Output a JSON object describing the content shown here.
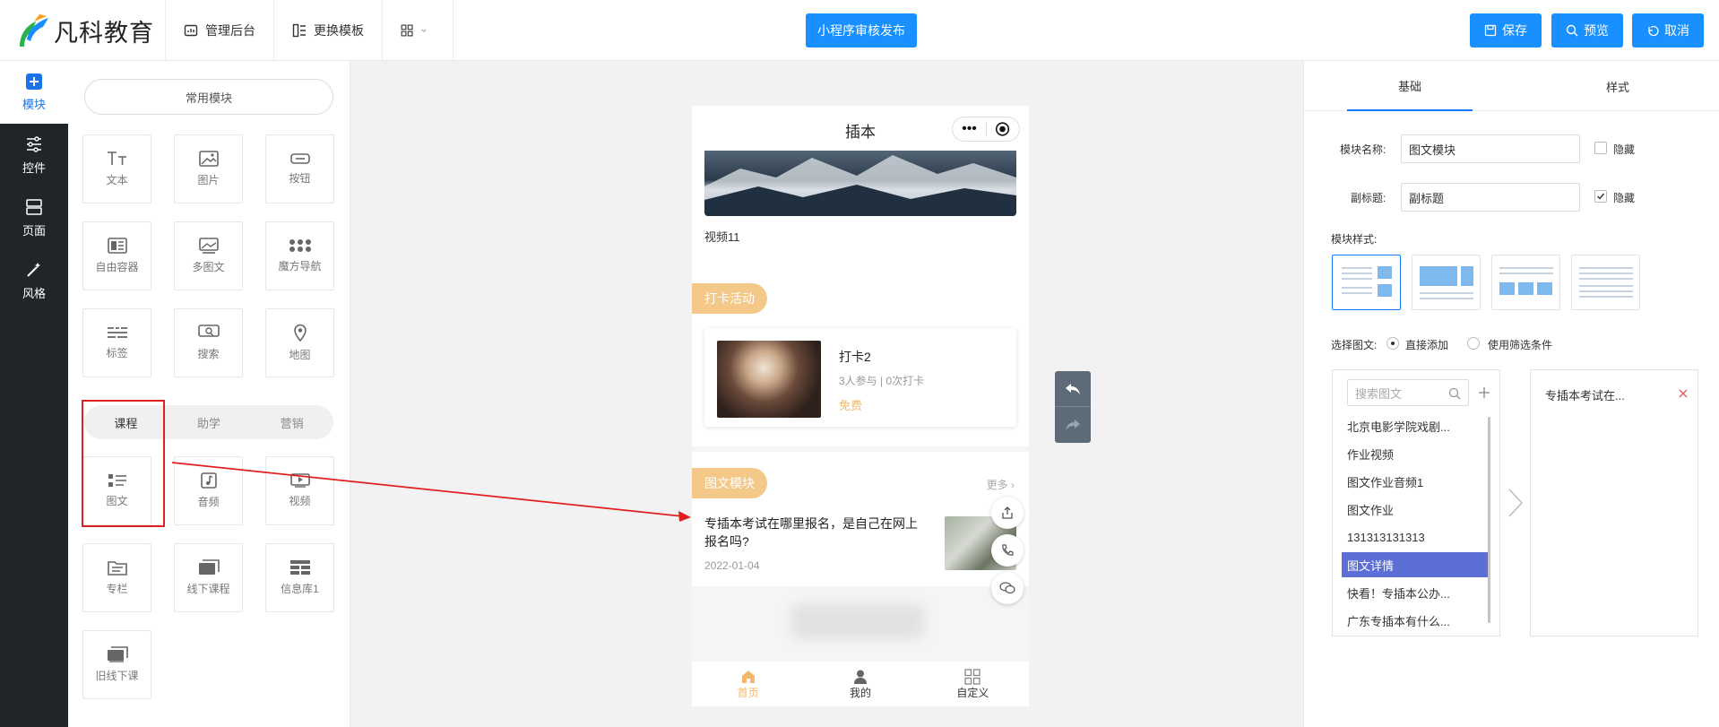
{
  "brand": {
    "name": "凡科教育"
  },
  "topnav": {
    "admin": "管理后台",
    "template": "更换模板",
    "publish": "小程序审核发布",
    "save": "保存",
    "preview": "预览",
    "cancel": "取消"
  },
  "rail": {
    "module": "模块",
    "control": "控件",
    "page": "页面",
    "style": "风格"
  },
  "modules": {
    "common_title": "常用模块",
    "common": [
      "文本",
      "图片",
      "按钮",
      "自由容器",
      "多图文",
      "魔方导航",
      "标签",
      "搜索",
      "地图"
    ],
    "tabs": [
      "课程",
      "助学",
      "营销"
    ],
    "course": [
      "图文",
      "音频",
      "视频",
      "专栏",
      "线下课程",
      "信息库1",
      "旧线下课"
    ]
  },
  "phone": {
    "title": "插本",
    "video_caption": "视频11",
    "checkin": {
      "tag": "打卡活动",
      "title": "打卡2",
      "meta": "3人参与 | 0次打卡",
      "price": "免费"
    },
    "article": {
      "tag": "图文模块",
      "more": "更多",
      "title": "专插本考试在哪里报名，是自己在网上报名吗?",
      "date": "2022-01-04"
    },
    "tabbar": [
      "首页",
      "我的",
      "自定义"
    ]
  },
  "settings": {
    "tab_basic": "基础",
    "tab_style": "样式",
    "name_label": "模块名称:",
    "name_value": "图文模块",
    "name_hide": "隐藏",
    "subtitle_label": "副标题:",
    "subtitle_value": "副标题",
    "subtitle_hide": "隐藏",
    "style_label": "模块样式:",
    "choose_label": "选择图文:",
    "opt_direct": "直接添加",
    "opt_filter": "使用筛选条件",
    "search_placeholder": "搜索图文",
    "list": [
      "北京电影学院戏剧...",
      "作业视频",
      "图文作业音频1",
      "图文作业",
      "131313131313",
      "图文详情",
      "快看！专插本公办...",
      "广东专插本有什么..."
    ],
    "selected": [
      "专插本考试在..."
    ]
  },
  "colors": {
    "accent": "#1890ff",
    "rail_bg": "#212529",
    "orange_tag": "#f3c888",
    "price": "#f3b96a",
    "annotation_red": "#e02020",
    "list_selected": "#5b6fd6"
  }
}
